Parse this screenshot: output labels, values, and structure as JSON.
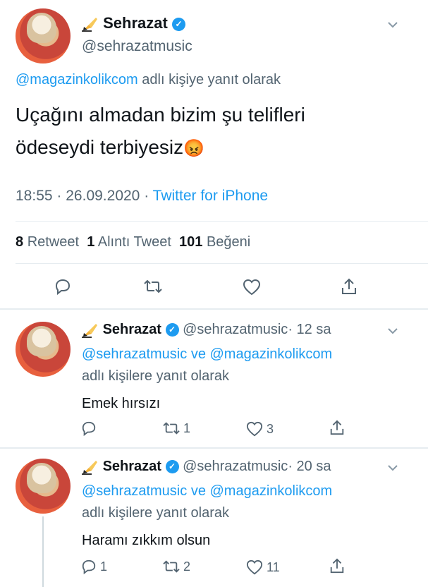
{
  "main_tweet": {
    "display_name": "Sehrazat",
    "handle": "@sehrazatmusic",
    "reply_prefix_user": "@magazinkolikcom",
    "reply_suffix": "adlı kişiye yanıt olarak",
    "text_line1": "Uçağını almadan bizim şu telifleri",
    "text_line2": "ödeseydi terbiyesiz",
    "emoji": "😡",
    "time": "18:55",
    "date": "26.09.2020",
    "separator": "·",
    "source": "Twitter for iPhone",
    "retweet_count": "8",
    "retweet_label": "Retweet",
    "quote_count": "1",
    "quote_label": "Alıntı Tweet",
    "like_count": "101",
    "like_label": "Beğeni"
  },
  "replies": [
    {
      "display_name": "Sehrazat",
      "handle": "@sehrazatmusic",
      "separator": "·",
      "time_ago": "12 sa",
      "mention1": "@sehrazatmusic",
      "connector": "ve",
      "mention2": "@magazinkolikcom",
      "reply_suffix": "adlı kişilere yanıt olarak",
      "text": "Emek hırsızı",
      "reply_count": "",
      "retweet_count": "1",
      "like_count": "3"
    },
    {
      "display_name": "Sehrazat",
      "handle": "@sehrazatmusic",
      "separator": "·",
      "time_ago": "20 sa",
      "mention1": "@sehrazatmusic",
      "connector": "ve",
      "mention2": "@magazinkolikcom",
      "reply_suffix": "adlı kişilere yanıt olarak",
      "text": "Haramı zıkkım olsun",
      "reply_count": "1",
      "retweet_count": "2",
      "like_count": "11"
    }
  ],
  "colors": {
    "link": "#1d9bf0",
    "secondary_text": "#536471",
    "divider": "#e6ecf0"
  },
  "icons": [
    "writing-hand-icon",
    "verified-badge-icon",
    "chevron-down-icon",
    "reply-icon",
    "retweet-icon",
    "like-icon",
    "share-icon"
  ]
}
